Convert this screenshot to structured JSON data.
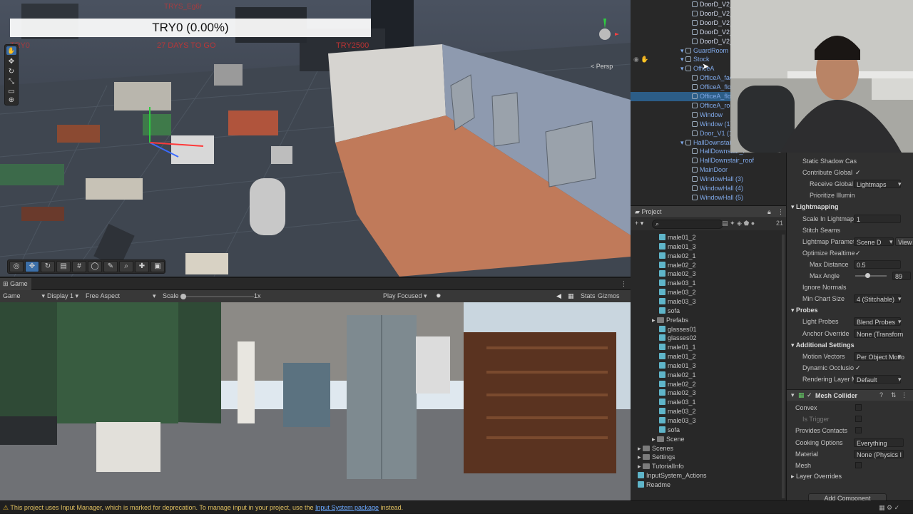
{
  "scene": {
    "overlay_title": "TRY0 (0.00%)",
    "red_text_left": "TRY0",
    "countdown": "27 DAYS TO GO",
    "red_text_top": "TRYS_Eg6r",
    "try_label": "TRY2500",
    "persp_label": "< Persp",
    "tool_icons": [
      "hand-icon",
      "move-icon",
      "rotate-icon",
      "scale-icon",
      "rect-icon",
      "transform-icon"
    ],
    "overlay_icons": [
      "orbit-icon",
      "move-icon",
      "rotate-icon",
      "snap-icon",
      "grid-icon",
      "globe-icon",
      "paint-icon",
      "search-icon",
      "pivot-icon",
      "center-icon"
    ]
  },
  "game": {
    "tab_label": "Game",
    "mode": "Game",
    "display": "Display 1",
    "aspect": "Free Aspect",
    "scale_label": "Scale",
    "scale_value": "1x",
    "play_mode": "Play Focused",
    "stats": "Stats",
    "gizmos": "Gizmos"
  },
  "hierarchy": {
    "items": [
      {
        "label": "DoorD_V2_Fr",
        "indent": 3,
        "blue": false
      },
      {
        "label": "DoorD_V2_Le",
        "indent": 3,
        "blue": false
      },
      {
        "label": "DoorD_V2_Ri",
        "indent": 3,
        "blue": false
      },
      {
        "label": "DoorD_V2_Wi",
        "indent": 3,
        "blue": false
      },
      {
        "label": "DoorD_V2_Wi",
        "indent": 3,
        "blue": false
      },
      {
        "label": "GuardRoom",
        "indent": 2,
        "blue": true
      },
      {
        "label": "Stock",
        "indent": 2,
        "blue": true
      },
      {
        "label": "OfficeA",
        "indent": 2,
        "blue": true
      },
      {
        "label": "OfficeA_facing",
        "indent": 3,
        "blue": true
      },
      {
        "label": "OfficeA_floor",
        "indent": 3,
        "blue": true
      },
      {
        "label": "OfficeA_floor (1",
        "indent": 3,
        "blue": true,
        "selected": true
      },
      {
        "label": "OfficeA_roof",
        "indent": 3,
        "blue": true
      },
      {
        "label": "Window",
        "indent": 3,
        "blue": true
      },
      {
        "label": "Window (1)",
        "indent": 3,
        "blue": true
      },
      {
        "label": "Door_V1 (1)",
        "indent": 3,
        "blue": true
      },
      {
        "label": "HallDownstair",
        "indent": 2,
        "blue": true
      },
      {
        "label": "HallDownstair_f",
        "indent": 3,
        "blue": true
      },
      {
        "label": "HallDownstair_roof",
        "indent": 3,
        "blue": true
      },
      {
        "label": "MainDoor",
        "indent": 3,
        "blue": true
      },
      {
        "label": "WindowHall (3)",
        "indent": 3,
        "blue": true
      },
      {
        "label": "WindowHall (4)",
        "indent": 3,
        "blue": true
      },
      {
        "label": "WindowHall (5)",
        "indent": 3,
        "blue": true
      }
    ]
  },
  "project": {
    "title": "Project",
    "count_badge": "21",
    "search_placeholder": "",
    "items": [
      {
        "label": "male01_2",
        "type": "asset",
        "indent": 4
      },
      {
        "label": "male01_3",
        "type": "asset",
        "indent": 4
      },
      {
        "label": "male02_1",
        "type": "asset",
        "indent": 4
      },
      {
        "label": "male02_2",
        "type": "asset",
        "indent": 4
      },
      {
        "label": "male02_3",
        "type": "asset",
        "indent": 4
      },
      {
        "label": "male03_1",
        "type": "asset",
        "indent": 4
      },
      {
        "label": "male03_2",
        "type": "asset",
        "indent": 4
      },
      {
        "label": "male03_3",
        "type": "asset",
        "indent": 4
      },
      {
        "label": "sofa",
        "type": "asset",
        "indent": 4
      },
      {
        "label": "Prefabs",
        "type": "folder",
        "indent": 3
      },
      {
        "label": "glasses01",
        "type": "asset",
        "indent": 4
      },
      {
        "label": "glasses02",
        "type": "asset",
        "indent": 4
      },
      {
        "label": "male01_1",
        "type": "asset",
        "indent": 4
      },
      {
        "label": "male01_2",
        "type": "asset",
        "indent": 4
      },
      {
        "label": "male01_3",
        "type": "asset",
        "indent": 4
      },
      {
        "label": "male02_1",
        "type": "asset",
        "indent": 4
      },
      {
        "label": "male02_2",
        "type": "asset",
        "indent": 4
      },
      {
        "label": "male02_3",
        "type": "asset",
        "indent": 4
      },
      {
        "label": "male03_1",
        "type": "asset",
        "indent": 4
      },
      {
        "label": "male03_2",
        "type": "asset",
        "indent": 4
      },
      {
        "label": "male03_3",
        "type": "asset",
        "indent": 4
      },
      {
        "label": "sofa",
        "type": "asset",
        "indent": 4
      },
      {
        "label": "Scene",
        "type": "folder",
        "indent": 3
      },
      {
        "label": "Scenes",
        "type": "folder",
        "indent": 1
      },
      {
        "label": "Settings",
        "type": "folder",
        "indent": 1
      },
      {
        "label": "TutorialInfo",
        "type": "folder",
        "indent": 1
      },
      {
        "label": "InputSystem_Actions",
        "type": "asset",
        "indent": 1
      },
      {
        "label": "Readme",
        "type": "asset",
        "indent": 1
      }
    ]
  },
  "inspector": {
    "rows": [
      {
        "kind": "label",
        "label": "Static Shadow Cas",
        "value": ""
      },
      {
        "kind": "check",
        "label": "Contribute Global",
        "value": "✓"
      },
      {
        "kind": "dropdown",
        "label": "Receive Global I",
        "value": "Lightmaps",
        "indent": true
      },
      {
        "kind": "label",
        "label": "Prioritize Illumin",
        "value": "",
        "indent": true
      },
      {
        "kind": "header",
        "label": "Lightmapping"
      },
      {
        "kind": "field",
        "label": "Scale In Lightmap",
        "value": "1"
      },
      {
        "kind": "label",
        "label": "Stitch Seams",
        "value": ""
      },
      {
        "kind": "dropdown",
        "label": "Lightmap Paramet",
        "value": "Scene D",
        "extra": "View"
      },
      {
        "kind": "check",
        "label": "Optimize Realtime",
        "value": "✓"
      },
      {
        "kind": "field",
        "label": "Max Distance",
        "value": "0.5",
        "indent": true
      },
      {
        "kind": "slider",
        "label": "Max Angle",
        "value": "89",
        "indent": true
      },
      {
        "kind": "label",
        "label": "Ignore Normals",
        "value": ""
      },
      {
        "kind": "dropdown",
        "label": "Min Chart Size",
        "value": "4 (Stitchable)"
      },
      {
        "kind": "header",
        "label": "Probes"
      },
      {
        "kind": "dropdown",
        "label": "Light Probes",
        "value": "Blend Probes"
      },
      {
        "kind": "field",
        "label": "Anchor Override",
        "value": "None (Transforn"
      },
      {
        "kind": "header",
        "label": "Additional Settings"
      },
      {
        "kind": "dropdown",
        "label": "Motion Vectors",
        "value": "Per Object Motio"
      },
      {
        "kind": "check",
        "label": "Dynamic Occlusio",
        "value": "✓"
      },
      {
        "kind": "dropdown",
        "label": "Rendering Layer M",
        "value": "Default"
      }
    ],
    "mesh_collider": {
      "title": "Mesh Collider",
      "rows": [
        {
          "label": "Convex",
          "value": ""
        },
        {
          "label": "Is Trigger",
          "value": "",
          "dim": true
        },
        {
          "label": "Provides Contacts",
          "value": ""
        },
        {
          "label": "Cooking Options",
          "value": "Everything"
        },
        {
          "label": "Material",
          "value": "None (Physics I"
        },
        {
          "label": "Mesh",
          "value": ""
        }
      ]
    },
    "layer_overrides": "Layer Overrides",
    "add_component": "Add Component"
  },
  "status": {
    "message": "This project uses Input Manager, which is marked for deprecation. To manage input in your project, use the",
    "link": "Input System package",
    "suffix": "instead."
  }
}
